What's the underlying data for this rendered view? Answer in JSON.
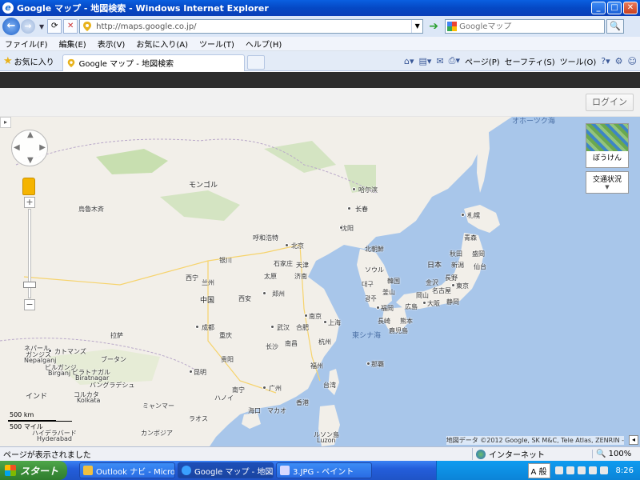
{
  "window": {
    "title": "Google マップ - 地図検索 - Windows Internet Explorer",
    "minimize": "_",
    "maximize": "□",
    "close": "✕"
  },
  "addressbar": {
    "url": "http://maps.google.co.jp/",
    "search_placeholder": "Googleマップ"
  },
  "menu": {
    "items": [
      "ファイル(F)",
      "編集(E)",
      "表示(V)",
      "お気に入り(A)",
      "ツール(T)",
      "ヘルプ(H)"
    ]
  },
  "favbar": {
    "favorites_label": "お気に入り",
    "tab_title": "Google マップ - 地図検索",
    "cmd_page": "ページ(P)",
    "cmd_safety": "セーフティ(S)",
    "cmd_tools": "ツール(O)"
  },
  "header": {
    "login_label": "ログイン"
  },
  "map": {
    "controls": {
      "zoom_in": "+",
      "zoom_out": "−",
      "thumb_label": "ぼうけん",
      "traffic_label": "交通状況"
    },
    "scale": {
      "km": "500 km",
      "mi": "500 マイル"
    },
    "copyright": "地図データ ©2012 Google, SK M&C, Tele Atlas, ZENRIN -",
    "labels": {
      "mongolia": "モンゴル",
      "ulaanbaatar": "烏魯木斉",
      "harbin": "哈尔滨",
      "changchun": "长春",
      "shenyang": "沈阳",
      "hohhot": "呼和浩特",
      "beijing": "北京",
      "tianjin": "天津",
      "yinchuan": "银川",
      "shijiazhuang": "石家庄",
      "taiyuan": "太原",
      "jinan": "济南",
      "xining": "西宁",
      "lanzhou": "兰州",
      "china": "中国",
      "xian": "西安",
      "zhengzhou": "郑州",
      "nanjing": "南京",
      "shanghai": "上海",
      "hefei": "合肥",
      "wuhan": "武汉",
      "hangzhou": "杭州",
      "chengdu": "成都",
      "chongqing": "重庆",
      "changsha": "长沙",
      "nanchang": "南昌",
      "lhasa": "拉萨",
      "guiyang": "贵阳",
      "fuzhou": "福州",
      "kunming": "昆明",
      "nanning": "南宁",
      "guangzhou": "广州",
      "taiwan": "台湾",
      "hongkong": "香港",
      "macau": "マカオ",
      "haikou": "海口",
      "hanoi": "ハノイ",
      "laos": "ラオス",
      "myanmar": "ミャンマー",
      "bhutan": "ブータン",
      "nepal": "ネパール",
      "kathmandu": "カトマンズ",
      "ganges": "ガンジス",
      "bangladesh": "バングラデシュ",
      "kolkata": "コルカタ",
      "india": "インド",
      "hyderabad": "ハイデラバード",
      "hyderabad_en": "Hyderabad",
      "biratnagar": "ビラトナガル",
      "biratnagar_en": "Biratnagar",
      "nepalgunj": "Nepalganj",
      "birganj": "ビルガンジ",
      "birganj_en": "Birganj",
      "kolkata_en": "Kolkata",
      "cambodia": "カンボジア",
      "luzon": "ルソン島",
      "luzon_en": "Luzon",
      "north_korea": "北朝鮮",
      "seoul": "ソウル",
      "korea": "韓国",
      "daegu": "대구",
      "busan": "釜山",
      "gwangju": "광주",
      "japan": "日本",
      "sapporo": "札幌",
      "aomori": "青森",
      "akita": "秋田",
      "morioka": "盛岡",
      "niigata": "新潟",
      "sendai": "仙台",
      "nagano": "長野",
      "kanazawa": "金沢",
      "nagoya": "名古屋",
      "tokyo": "東京",
      "shizuoka": "静岡",
      "okayama": "岡山",
      "hiroshima": "広島",
      "osaka": "大阪",
      "fukuoka": "福岡",
      "nagasaki": "長崎",
      "kumamoto": "熊本",
      "kagoshima": "鹿児島",
      "naha": "那覇",
      "east_china_sea": "東シナ海",
      "okhotsk": "オホーツク海"
    }
  },
  "status": {
    "message": "ページが表示されました",
    "zone": "インターネット",
    "zoom": "100%"
  },
  "taskbar": {
    "start_label": "スタート",
    "tasks": [
      "Outlook ナビ - Micros...",
      "Google マップ - 地図...",
      "3.JPG - ペイント"
    ],
    "ime": "A 般",
    "clock": "8:26"
  }
}
